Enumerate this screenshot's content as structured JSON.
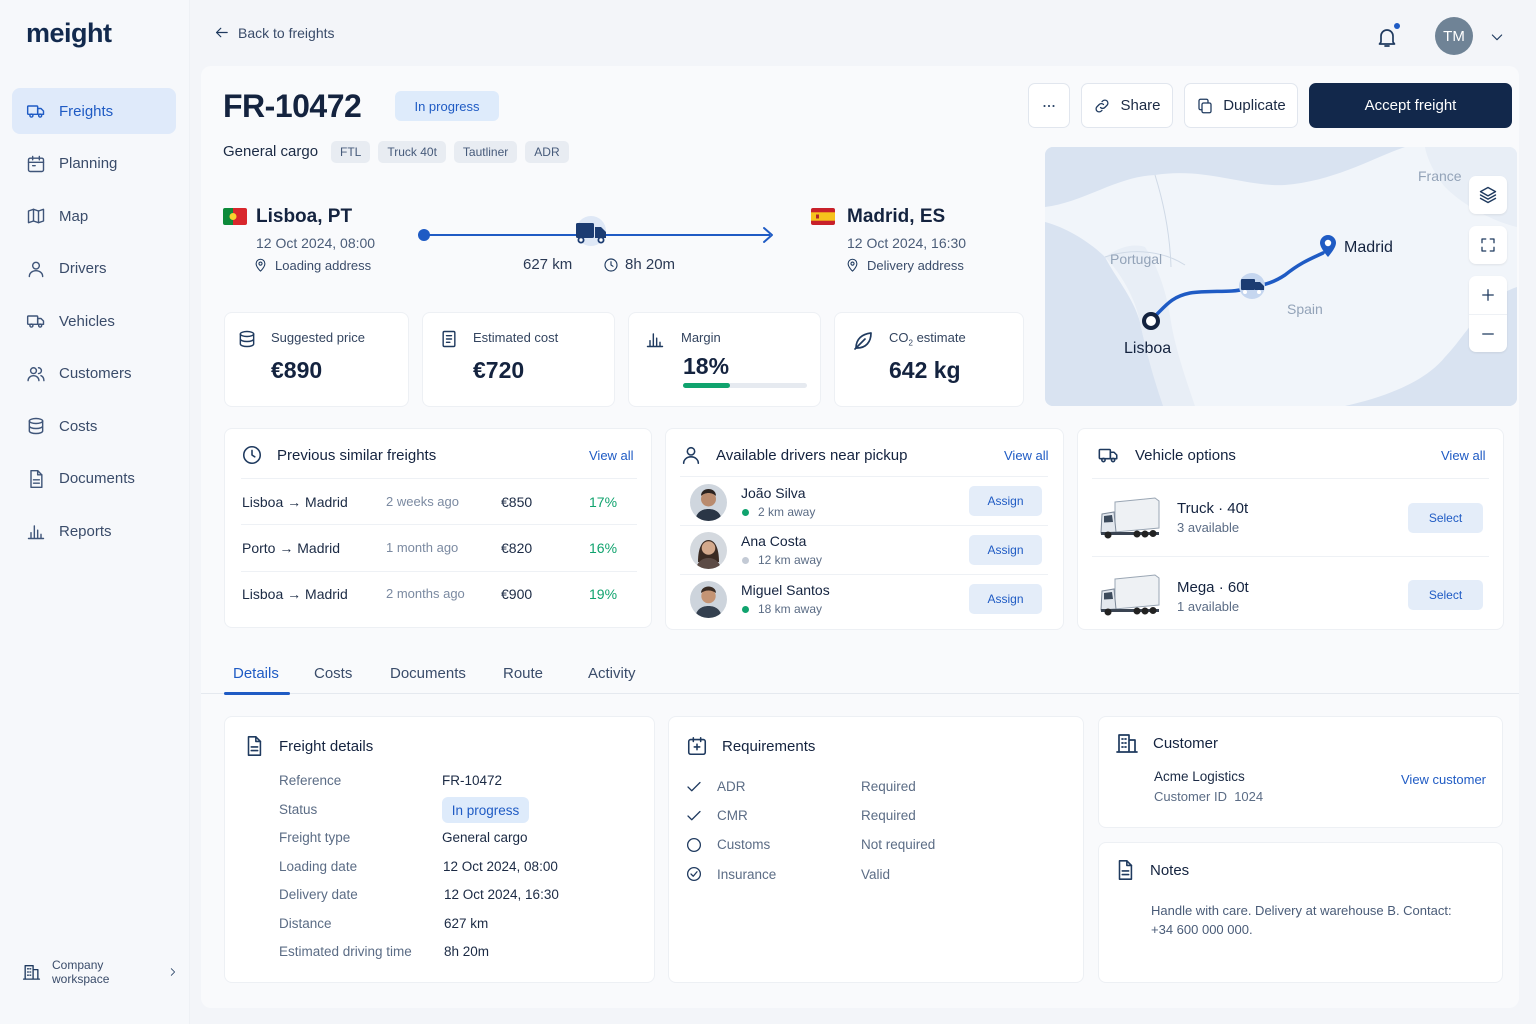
{
  "app": {
    "logo": "meight"
  },
  "sidebar": {
    "items": [
      {
        "label": "Freights",
        "icon": "truck-icon",
        "active": true
      },
      {
        "label": "Planning",
        "icon": "calendar-icon"
      },
      {
        "label": "Map",
        "icon": "map-icon"
      },
      {
        "label": "Drivers",
        "icon": "user-icon"
      },
      {
        "label": "Vehicles",
        "icon": "truck-icon"
      },
      {
        "label": "Customers",
        "icon": "users-icon"
      },
      {
        "label": "Costs",
        "icon": "coins-icon"
      },
      {
        "label": "Documents",
        "icon": "document-icon"
      },
      {
        "label": "Reports",
        "icon": "bar-chart-icon"
      }
    ],
    "workspace": "Company workspace"
  },
  "header": {
    "back_label": "Back to freights",
    "avatar_initials": "TM"
  },
  "freight": {
    "id": "FR-10472",
    "status": "In progress",
    "cargo": "General cargo",
    "tags": [
      "FTL",
      "Truck 40t",
      "Tautliner",
      "ADR"
    ]
  },
  "actions": {
    "share": "Share",
    "duplicate": "Duplicate",
    "accept": "Accept freight"
  },
  "route": {
    "origin": {
      "city": "Lisboa, PT",
      "datetime": "12 Oct 2024, 08:00",
      "address": "Loading address"
    },
    "destination": {
      "city": "Madrid, ES",
      "datetime": "12 Oct 2024, 16:30",
      "address": "Delivery address"
    },
    "distance": "627 km",
    "duration": "8h 20m"
  },
  "metrics": {
    "price": {
      "label": "Suggested price",
      "value": "€890"
    },
    "cost": {
      "label": "Estimated cost",
      "value": "€720"
    },
    "margin": {
      "label": "Margin",
      "value": "18%",
      "fraction": 0.38
    },
    "co2": {
      "label_prefix": "CO",
      "label_sub": "2",
      "label_suffix": " estimate",
      "value": "642 kg"
    }
  },
  "map": {
    "country_france": "France",
    "country_portugal": "Portugal",
    "country_spain": "Spain",
    "city_from": "Lisboa",
    "city_to": "Madrid"
  },
  "similar": {
    "title": "Previous similar freights",
    "view_all": "View all",
    "rows": [
      {
        "route": "Lisboa → Madrid",
        "when": "2 weeks ago",
        "price": "€850",
        "margin": "17%"
      },
      {
        "route": "Porto → Madrid",
        "when": "1 month ago",
        "price": "€820",
        "margin": "16%"
      },
      {
        "route": "Lisboa → Madrid",
        "when": "2 months ago",
        "price": "€900",
        "margin": "19%"
      }
    ]
  },
  "drivers": {
    "title": "Available drivers near pickup",
    "view_all": "View all",
    "assign": "Assign",
    "rows": [
      {
        "name": "João Silva",
        "distance": "2 km away",
        "dot": "#10a36e"
      },
      {
        "name": "Ana Costa",
        "distance": "12 km away",
        "dot": "#c3cad5"
      },
      {
        "name": "Miguel Santos",
        "distance": "18 km away",
        "dot": "#10a36e"
      }
    ]
  },
  "vehicles": {
    "title": "Vehicle options",
    "view_all": "View all",
    "select": "Select",
    "rows": [
      {
        "name": "Truck · 40t",
        "avail": "3 available"
      },
      {
        "name": "Mega · 60t",
        "avail": "1 available"
      }
    ]
  },
  "tabs": [
    "Details",
    "Costs",
    "Documents",
    "Route",
    "Activity"
  ],
  "details": {
    "title": "Freight details",
    "rows": [
      {
        "k": "Reference",
        "v": "FR-10472"
      },
      {
        "k": "Status",
        "v": "In progress"
      },
      {
        "k": "Freight type",
        "v": "General cargo"
      },
      {
        "k": "Loading date",
        "v": "12 Oct 2024, 08:00"
      },
      {
        "k": "Delivery date",
        "v": "12 Oct 2024, 16:30"
      },
      {
        "k": "Distance",
        "v": "627 km"
      },
      {
        "k": "Estimated driving time",
        "v": "8h 20m"
      }
    ]
  },
  "requirements": {
    "title": "Requirements",
    "rows": [
      {
        "k": "ADR",
        "v": "Required",
        "icon": "check-icon"
      },
      {
        "k": "CMR",
        "v": "Required",
        "icon": "check-icon"
      },
      {
        "k": "Customs",
        "v": "Not required",
        "icon": "circle-icon"
      },
      {
        "k": "Insurance",
        "v": "Valid",
        "icon": "check-circle-icon"
      }
    ]
  },
  "customer": {
    "title": "Customer",
    "name": "Acme Logistics",
    "id_label": "Customer ID",
    "id": "1024",
    "view": "View customer"
  },
  "notes": {
    "title": "Notes",
    "line1": "Handle with care. Delivery at warehouse B. Contact:",
    "line2": "+34 600 000 000."
  }
}
